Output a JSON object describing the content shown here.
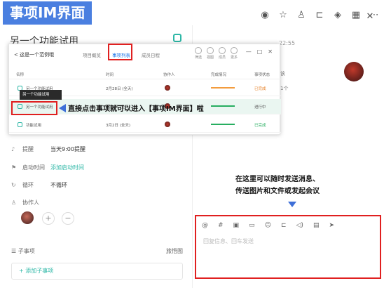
{
  "banner": {
    "title": "事项IM界面"
  },
  "top_icons": [
    "eye-icon",
    "star-icon",
    "people-icon",
    "share-icon",
    "layers-icon",
    "grid-icon",
    "dots-icon"
  ],
  "item": {
    "title": "另一个功能试用"
  },
  "tabs": [
    {
      "label": "< 这是一个范例哦",
      "active": false
    },
    {
      "label": "项目概览",
      "active": false
    },
    {
      "label": "事项列表",
      "active": true
    },
    {
      "label": "成员日程",
      "active": false
    }
  ],
  "list_window": {
    "toolbar": [
      "筛选",
      "视图",
      "成员",
      "更多"
    ],
    "columns": [
      "名称",
      "时间",
      "协作人",
      "完成情况",
      "事项状态"
    ],
    "rows": [
      {
        "name": "另一个功能试用",
        "time": "2月28日 (全天)",
        "status": "已完成",
        "bar_color": "#f39c3d"
      },
      {
        "name": "另一个功能试用",
        "time": "3月1日 (全天)",
        "status": "进行中",
        "bar_color": "#27ae60"
      },
      {
        "name": "功能试用",
        "time": "3月2日 (全天)",
        "status": "已完成",
        "bar_color": "#27ae60"
      }
    ],
    "tooltip": "另一个功能试用"
  },
  "callout_left": "直接点击事项就可以进入【事项IM界面】啦",
  "fields": {
    "reminder_label": "提醒",
    "reminder_value": "当天9:00提醒",
    "start_label": "启动时间",
    "start_value": "添加启动时间",
    "repeat_label": "循环",
    "repeat_value": "不循环",
    "collab_label": "协作人"
  },
  "subitems": {
    "label": "子事项",
    "right": "旅悟图",
    "add": "+ 添加子事项"
  },
  "chat": {
    "time": "22:55",
    "snip1": "该",
    "snip2": "1个"
  },
  "callout_right": [
    "在这里可以随时发送消息、",
    "传送图片和文件或发起会议"
  ],
  "composer": {
    "tools": [
      "@",
      "#",
      "image-icon",
      "folder-icon",
      "emoji-icon",
      "branch-icon",
      "voice-icon",
      "card-icon",
      "send-icon"
    ],
    "placeholder": "回复信息、回车发送"
  }
}
